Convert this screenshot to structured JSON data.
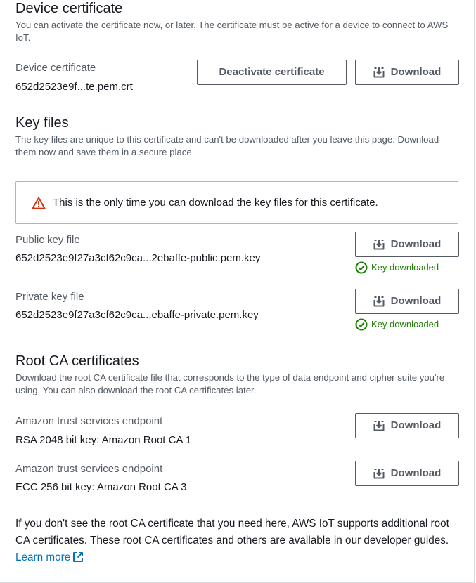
{
  "device_certificate": {
    "heading": "Device certificate",
    "description": "You can activate the certificate now, or later. The certificate must be active for a device to connect to AWS IoT.",
    "label": "Device certificate",
    "filename": "652d2523e9f...te.pem.crt",
    "deactivate_label": "Deactivate certificate",
    "download_label": "Download",
    "download_icon": "download-icon"
  },
  "key_files": {
    "heading": "Key files",
    "description": "The key files are unique to this certificate and can't be downloaded after you leave this page. Download them now and save them in a secure place.",
    "alert_text": "This is the only time you can download the key files for this certificate.",
    "alert_icon": "warning-icon",
    "public": {
      "label": "Public key file",
      "filename": "652d2523e9f27a3cf62c9ca...2ebaffe-public.pem.key",
      "download_label": "Download",
      "status": "Key downloaded",
      "status_icon": "check-circle-icon"
    },
    "private": {
      "label": "Private key file",
      "filename": "652d2523e9f27a3cf62c9ca...ebaffe-private.pem.key",
      "download_label": "Download",
      "status": "Key downloaded",
      "status_icon": "check-circle-icon"
    }
  },
  "root_ca": {
    "heading": "Root CA certificates",
    "description": "Download the root CA certificate file that corresponds to the type of data endpoint and cipher suite you're using. You can also download the root CA certificates later.",
    "items": [
      {
        "label": "Amazon trust services endpoint",
        "value": "RSA 2048 bit key: Amazon Root CA 1",
        "download_label": "Download"
      },
      {
        "label": "Amazon trust services endpoint",
        "value": "ECC 256 bit key: Amazon Root CA 3",
        "download_label": "Download"
      }
    ],
    "footer_text": "If you don't see the root CA certificate that you need here, AWS IoT supports additional root CA certificates. These root CA certificates and others are available in our developer guides.",
    "learn_more": "Learn more",
    "external_icon": "external-link-icon"
  },
  "colors": {
    "text": "#16191f",
    "secondary_text": "#545b64",
    "link": "#0073bb",
    "success": "#1d8102",
    "warning": "#d13212",
    "border": "#aab7b8"
  }
}
